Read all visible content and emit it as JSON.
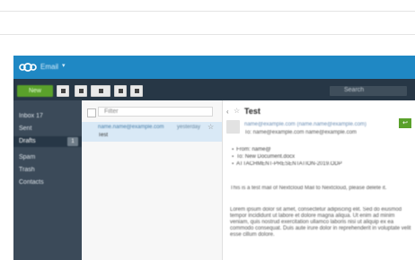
{
  "topbar": {
    "app_title": "Email",
    "chevron": "▾",
    "logo_icon": "nextcloud-logo"
  },
  "toolbar": {
    "new_label": "New",
    "search_placeholder": "Search"
  },
  "sidebar": {
    "items": [
      {
        "label": "Inbox 17"
      },
      {
        "label": "Sent"
      },
      {
        "label": "Drafts",
        "badge": "1"
      },
      {
        "label": "Spam"
      },
      {
        "label": "Trash"
      },
      {
        "label": "Contacts"
      }
    ]
  },
  "message_list": {
    "filter_text": "Filter",
    "rows": [
      {
        "sender": "name.name@example.com",
        "date": "yesterday",
        "subject": "Test"
      }
    ]
  },
  "reader": {
    "title": "Test",
    "from": "name@example.com  (name.name@example.com)",
    "to": "To: name@example.com  name@example.com",
    "attachments": [
      {
        "label": "From:  name@"
      },
      {
        "label": "To:  New Document.docx"
      },
      {
        "label": "ATTACHMENT-PRESENTATION-2019.ODP"
      }
    ],
    "body": [
      "This is a test mail of Nextcloud Mail to Nextcloud, please delete it.",
      "Lorem ipsum dolor sit amet, consectetur adipiscing elit. Sed do eiusmod tempor incididunt ut labore et dolore magna aliqua. Ut enim ad minim veniam, quis nostrud exercitation ullamco laboris nisi ut aliquip ex ea commodo consequat. Duis aute irure dolor in reprehenderit in voluptate velit esse cillum dolore."
    ]
  },
  "colors": {
    "topbar": "#1f88c4",
    "toolbar": "#273746",
    "sidebar": "#3b4a59",
    "accent_green": "#5aa12b",
    "selected_row": "#d9e9f6"
  }
}
